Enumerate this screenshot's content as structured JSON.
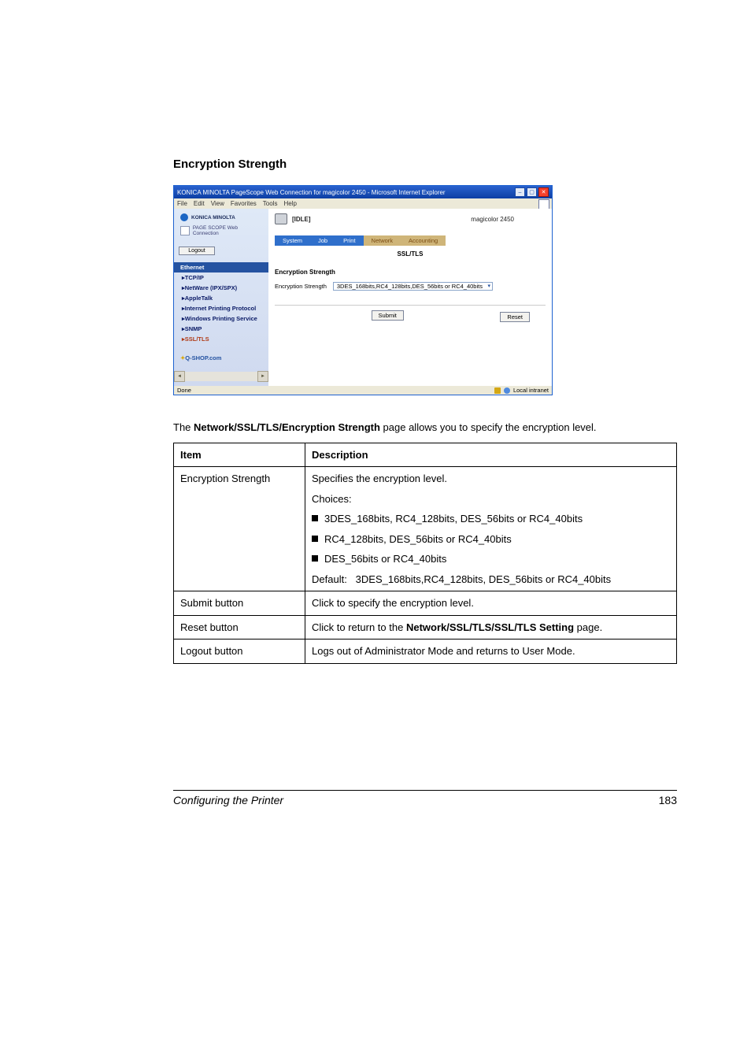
{
  "section_title": "Encryption Strength",
  "browser": {
    "title": "KONICA MINOLTA PageScope Web Connection for magicolor 2450 - Microsoft Internet Explorer",
    "menus": [
      "File",
      "Edit",
      "View",
      "Favorites",
      "Tools",
      "Help"
    ],
    "brand_line1": "KONICA MINOLTA",
    "brand_line2": "PAGE SCOPE  Web Connection",
    "logout_label": "Logout",
    "sidebar": {
      "header": "Ethernet",
      "items": [
        {
          "label": "▸TCP/IP",
          "active": false
        },
        {
          "label": "▸NetWare (IPX/SPX)",
          "active": false
        },
        {
          "label": "▸AppleTalk",
          "active": false
        },
        {
          "label": "▸Internet Printing Protocol",
          "active": false
        },
        {
          "label": "▸Windows Printing Service",
          "active": false
        },
        {
          "label": "▸SNMP",
          "active": false
        },
        {
          "label": "▸SSL/TLS",
          "active": true
        }
      ],
      "qshop": "Q-SHOP.com"
    },
    "main": {
      "idle": "[IDLE]",
      "model": "magicolor 2450",
      "tabs": [
        "System",
        "Job",
        "Print",
        "Network",
        "Accounting"
      ],
      "subtitle": "SSL/TLS",
      "form_heading": "Encryption Strength",
      "field_label": "Encryption Strength",
      "field_value": "3DES_168bits,RC4_128bits,DES_56bits or RC4_40bits",
      "submit": "Submit",
      "reset": "Reset"
    },
    "status": {
      "left": "Done",
      "zone": "Local intranet"
    }
  },
  "intro": {
    "prefix": "The ",
    "strong": "Network/SSL/TLS/Encryption Strength",
    "suffix": " page allows you to specify the encryption level."
  },
  "table": {
    "head": {
      "col1": "Item",
      "col2": "Description"
    },
    "rows": [
      {
        "item": "Encryption Strength",
        "desc_lead": "Specifies the encryption level.",
        "choices_label": "Choices:",
        "choices": [
          "3DES_168bits, RC4_128bits, DES_56bits or RC4_40bits",
          "RC4_128bits, DES_56bits or RC4_40bits",
          "DES_56bits or RC4_40bits"
        ],
        "default_label": "Default:",
        "default_value": "3DES_168bits,RC4_128bits, DES_56bits or RC4_40bits"
      },
      {
        "item": "Submit button",
        "desc": "Click to specify the encryption level."
      },
      {
        "item": "Reset button",
        "desc_prefix": "Click to return to the ",
        "desc_strong": "Network/SSL/TLS/SSL/TLS Setting",
        "desc_suffix": " page."
      },
      {
        "item": "Logout button",
        "desc": "Logs out of Administrator Mode and returns to User Mode."
      }
    ]
  },
  "footer": {
    "left": "Configuring the Printer",
    "right": "183"
  }
}
